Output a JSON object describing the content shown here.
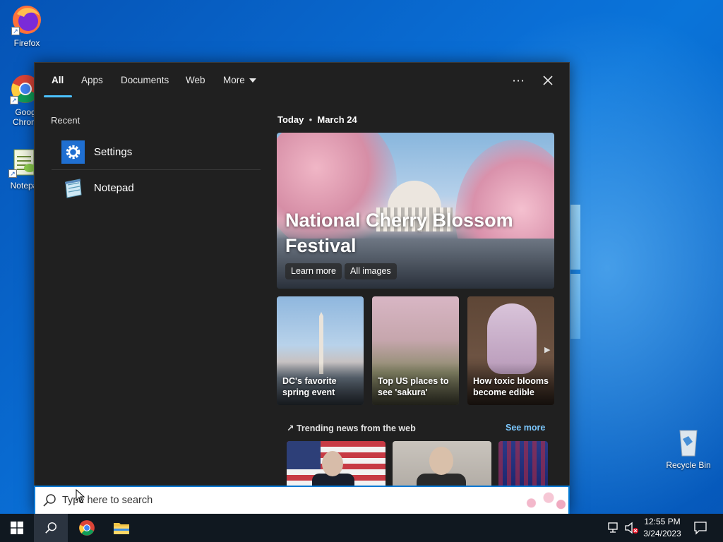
{
  "desktop": {
    "icons": [
      {
        "label": "Firefox"
      },
      {
        "label": "Goog… Chrom…",
        "line1": "Goog",
        "line2": "Chrom"
      },
      {
        "label": "Notepa"
      },
      {
        "label": "Recycle Bin"
      }
    ]
  },
  "search_panel": {
    "tabs": [
      {
        "label": "All",
        "active": true
      },
      {
        "label": "Apps"
      },
      {
        "label": "Documents"
      },
      {
        "label": "Web"
      },
      {
        "label": "More"
      }
    ],
    "more_options_icon": "ellipsis-icon",
    "close_icon": "close-icon",
    "recent": {
      "title": "Recent",
      "items": [
        {
          "label": "Settings",
          "icon": "gear-icon"
        },
        {
          "label": "Notepad",
          "icon": "notepad-icon"
        }
      ]
    },
    "today": {
      "prefix": "Today",
      "separator": "•",
      "date": "March 24"
    },
    "hero": {
      "title": "National Cherry Blossom Festival",
      "buttons": [
        {
          "label": "Learn more"
        },
        {
          "label": "All images"
        }
      ]
    },
    "cards": [
      {
        "title": "DC's favorite spring event"
      },
      {
        "title": "Top US places to see 'sakura'"
      },
      {
        "title": "How toxic blooms become edible"
      }
    ],
    "trending": {
      "title": "Trending news from the web",
      "see_more": "See more"
    }
  },
  "searchbox": {
    "placeholder": "Type here to search"
  },
  "taskbar": {
    "clock_time": "12:55 PM",
    "clock_date": "3/24/2023"
  },
  "colors": {
    "accent": "#0078d4",
    "link": "#7cc8ff",
    "panel_bg": "#202020",
    "taskbar_bg": "#101820"
  }
}
